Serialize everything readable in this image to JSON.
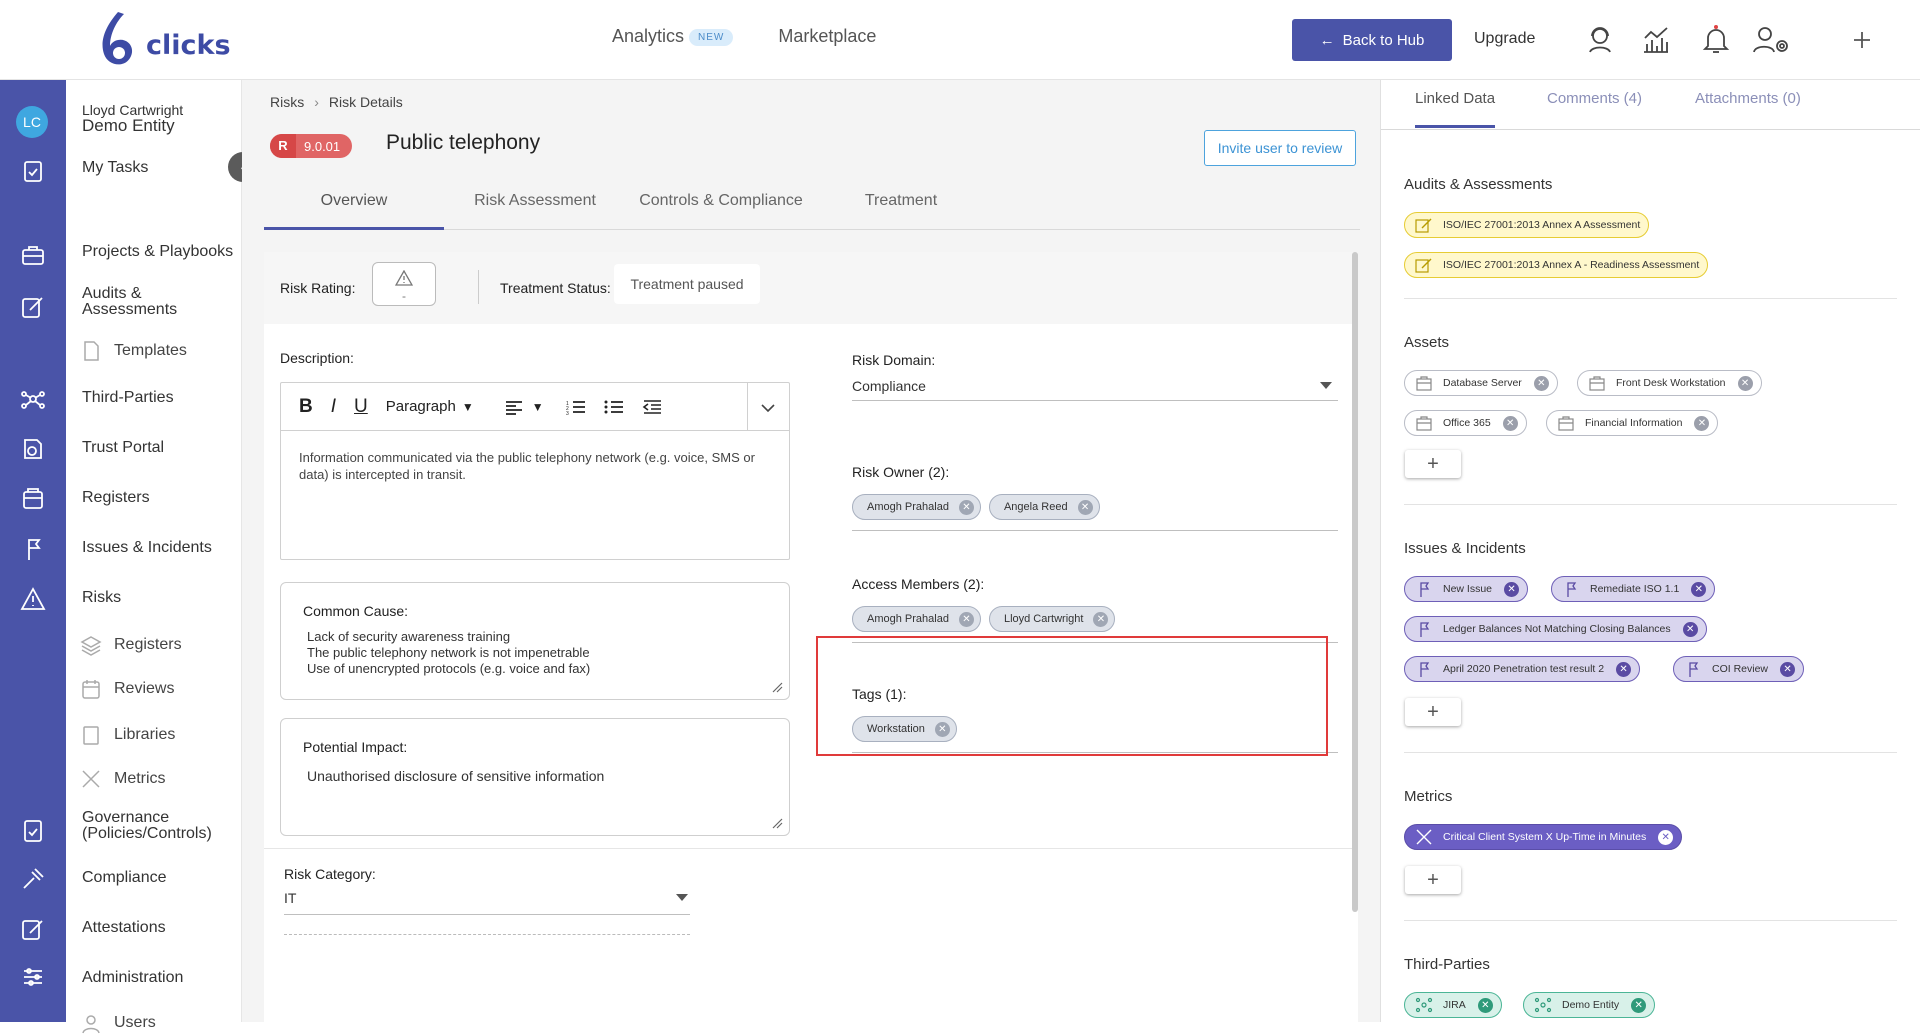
{
  "header": {
    "logo_text": "clicks",
    "nav": [
      {
        "label": "Analytics",
        "badge": "NEW"
      },
      {
        "label": "Marketplace"
      }
    ],
    "back_to_hub": "Back to Hub",
    "upgrade": "Upgrade",
    "icons": [
      "support-agent-icon",
      "analytics-chart-icon",
      "bell-icon",
      "user-settings-icon",
      "plus-icon"
    ]
  },
  "rail": {
    "avatar_initials": "LC"
  },
  "sidebar": {
    "user_name": "Lloyd Cartwright",
    "entity": "Demo Entity",
    "items": [
      "My Tasks",
      "Projects & Playbooks",
      "Audits &\nAssessments",
      "Templates",
      "Third-Parties",
      "Trust Portal",
      "Registers",
      "Issues & Incidents",
      "Risks",
      "Registers",
      "Reviews",
      "Libraries",
      "Metrics",
      "Governance (Policies/Controls)",
      "Compliance",
      "Attestations",
      "Administration",
      "Users"
    ]
  },
  "breadcrumb": {
    "parent": "Risks",
    "current": "Risk Details"
  },
  "risk": {
    "badge_letter": "R",
    "badge_number": "9.0.01",
    "title": "Public telephony",
    "invite_label": "Invite user to review"
  },
  "tabs": [
    "Overview",
    "Risk Assessment",
    "Controls & Compliance",
    "Treatment"
  ],
  "overview": {
    "risk_rating_label": "Risk Rating:",
    "risk_rating_value": "-",
    "treatment_status_label": "Treatment Status:",
    "treatment_status_value": "Treatment paused",
    "description_label": "Description:",
    "editor_toolbar": {
      "bold": "B",
      "italic": "I",
      "underline": "U",
      "paragraph": "Paragraph"
    },
    "description_text": "Information communicated via the public telephony network (e.g. voice, SMS or data) is intercepted in transit.",
    "common_cause_label": "Common Cause:",
    "common_cause_lines": [
      "Lack of security awareness training",
      "The public telephony network is not impenetrable",
      "Use of unencrypted protocols (e.g. voice and fax)"
    ],
    "potential_impact_label": "Potential Impact:",
    "potential_impact_text": "Unauthorised disclosure of sensitive information",
    "risk_domain_label": "Risk Domain:",
    "risk_domain_value": "Compliance",
    "risk_owner_label": "Risk Owner (2):",
    "risk_owners": [
      "Amogh Prahalad",
      "Angela Reed"
    ],
    "access_members_label": "Access Members (2):",
    "access_members": [
      "Amogh Prahalad",
      "Lloyd Cartwright"
    ],
    "tags_label": "Tags (1):",
    "tags": [
      "Workstation"
    ],
    "risk_category_label": "Risk Category:",
    "risk_category_value": "IT"
  },
  "linked": {
    "tabs": [
      "Linked Data",
      "Comments (4)",
      "Attachments (0)"
    ],
    "audits_title": "Audits & Assessments",
    "audits": [
      "ISO/IEC 27001:2013 Annex A Assessment",
      "ISO/IEC 27001:2013 Annex A - Readiness Assessment"
    ],
    "assets_title": "Assets",
    "assets": [
      "Database Server",
      "Front Desk Workstation",
      "Office 365",
      "Financial Information"
    ],
    "issues_title": "Issues & Incidents",
    "issues": [
      "New Issue",
      "Remediate ISO 1.1",
      "Ledger Balances Not Matching Closing Balances",
      "April 2020 Penetration test result 2",
      "COI Review"
    ],
    "metrics_title": "Metrics",
    "metrics": [
      "Critical Client System X Up-Time in Minutes"
    ],
    "third_parties_title": "Third-Parties",
    "third_parties": [
      "JIRA",
      "Demo Entity"
    ],
    "add_label": "+"
  }
}
